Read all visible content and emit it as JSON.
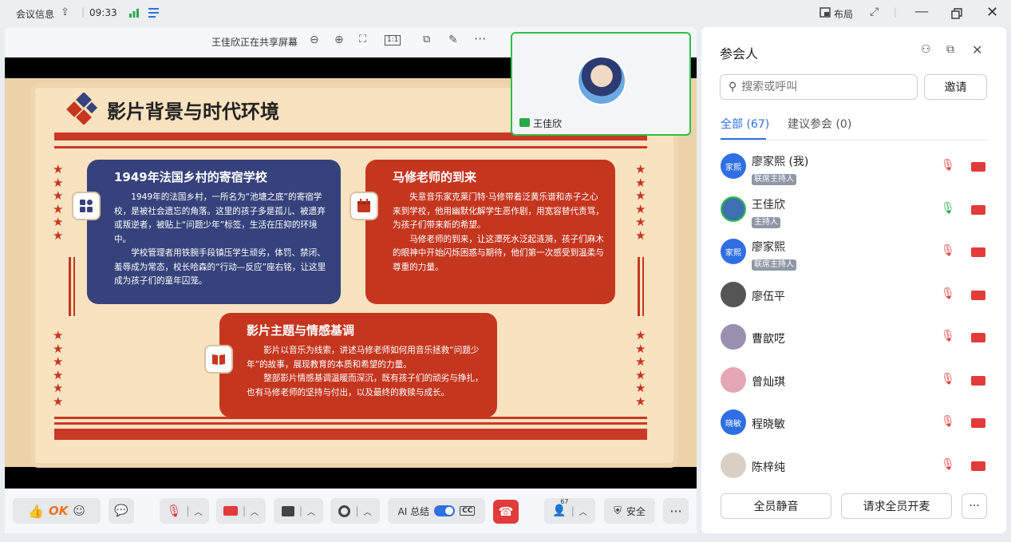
{
  "topbar": {
    "title": "会议信息",
    "time": "09:33",
    "layout_label": "布局"
  },
  "share": {
    "status": "王佳欣正在共享屏幕"
  },
  "slide": {
    "title": "影片背景与时代环境",
    "card1": {
      "title": "1949年法国乡村的寄宿学校",
      "p1": "1949年的法国乡村，一所名为“池塘之底”的寄宿学校，是被社会遗忘的角落。这里的孩子多是孤儿、被遗弃或叛逆者，被贴上“问题少年”标签，生活在压抑的环境中。",
      "p2": "学校管理者用铁腕手段镇压学生顽劣，体罚、禁闭、羞辱成为常态，校长哈森的“行动—反应”座右铭，让这里成为孩子们的童年囚笼。"
    },
    "card2": {
      "title": "马修老师的到来",
      "p1": "失意音乐家克莱门特·马修带着泛黄乐谱和赤子之心来到学校，他用幽默化解学生恶作剧，用宽容替代责骂，为孩子们带来新的希望。",
      "p2": "马修老师的到来，让这潭死水泛起涟漪，孩子们麻木的眼神中开始闪烁困惑与期待，他们第一次感受到温柔与尊重的力量。"
    },
    "card3": {
      "title": "影片主题与情感基调",
      "p1": "影片以音乐为线索，讲述马修老师如何用音乐拯救“问题少年”的故事，展现教育的本质和希望的力量。",
      "p2": "整部影片情感基调温暖而深沉，既有孩子们的顽劣与挣扎，也有马修老师的坚持与付出，以及最终的救赎与成长。"
    }
  },
  "video": {
    "name": "王佳欣"
  },
  "bottombar": {
    "ok": "OK",
    "ai_label": "AI 总结",
    "cc": "CC",
    "participants_count": "67",
    "security": "安全"
  },
  "panel": {
    "title": "参会人",
    "search_placeholder": "搜索或呼叫",
    "invite": "邀请",
    "tab_all": "全部 (67)",
    "tab_suggest": "建议参会 (0)",
    "participants": [
      {
        "name": "廖家熙 (我)",
        "role": "联席主持人",
        "avatar": "家熙",
        "color": "#2f6fe3"
      },
      {
        "name": "王佳欣",
        "role": "主持人",
        "avatar": "",
        "color": "#3e6fb0"
      },
      {
        "name": "廖家熙",
        "role": "联席主持人",
        "avatar": "家熙",
        "color": "#2f6fe3"
      },
      {
        "name": "廖伍平",
        "role": "",
        "avatar": "",
        "color": "#555"
      },
      {
        "name": "曹歆呓",
        "role": "",
        "avatar": "",
        "color": "#9a8fae"
      },
      {
        "name": "曾灿琪",
        "role": "",
        "avatar": "",
        "color": "#e5a6b5"
      },
      {
        "name": "程晓敏",
        "role": "",
        "avatar": "晓敏",
        "color": "#2f6fe3"
      },
      {
        "name": "陈梓纯",
        "role": "",
        "avatar": "",
        "color": "#d9cfc5"
      }
    ],
    "mute_all": "全员静音",
    "request_unmute": "请求全员开麦",
    "more": "···"
  }
}
